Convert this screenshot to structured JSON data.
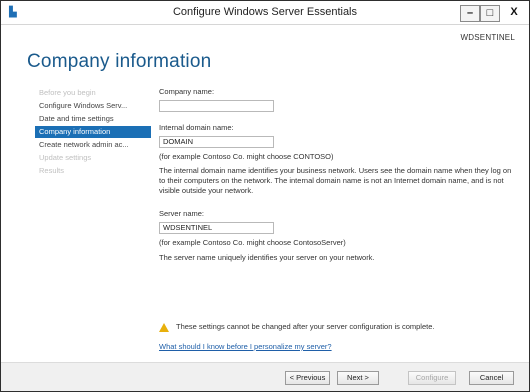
{
  "window": {
    "title": "Configure Windows Server Essentials",
    "app_icon": "server-icon",
    "min_label": "–",
    "max_label": "□",
    "close_label": "X"
  },
  "server_name_tag": "WDSENTINEL",
  "page_title": "Company information",
  "nav": {
    "items": [
      {
        "label": "Before you begin",
        "state": "disabled"
      },
      {
        "label": "Configure Windows Serv...",
        "state": "normal"
      },
      {
        "label": "Date and time settings",
        "state": "normal"
      },
      {
        "label": "Company information",
        "state": "selected"
      },
      {
        "label": "Create network admin ac...",
        "state": "normal"
      },
      {
        "label": "Update settings",
        "state": "disabled"
      },
      {
        "label": "Results",
        "state": "disabled"
      }
    ]
  },
  "form": {
    "company_name": {
      "label": "Company name:",
      "value": ""
    },
    "domain": {
      "label": "Internal domain name:",
      "value": "DOMAIN",
      "example": "(for example Contoso Co. might choose CONTOSO)",
      "description": "The internal domain name identifies your business network. Users see the domain name when they log on to their computers on the network. The internal domain name is not an Internet domain name, and is not visible outside your network."
    },
    "server": {
      "label": "Server name:",
      "value": "WDSENTINEL",
      "example": "(for example Contoso Co. might choose ContosoServer)",
      "description": "The server name uniquely identifies your server on your network."
    }
  },
  "warning": {
    "icon": "warning-icon",
    "text": "These settings cannot be changed after your server configuration is complete."
  },
  "help_link": "What should I know before I personalize my server?",
  "footer": {
    "previous": "< Previous",
    "next": "Next >",
    "configure": "Configure",
    "cancel": "Cancel"
  },
  "colors": {
    "title_blue": "#1a5a8c",
    "selected_nav": "#1b6fb5",
    "warning_yellow": "#e8b00c",
    "link_blue": "#1f5fa8"
  }
}
